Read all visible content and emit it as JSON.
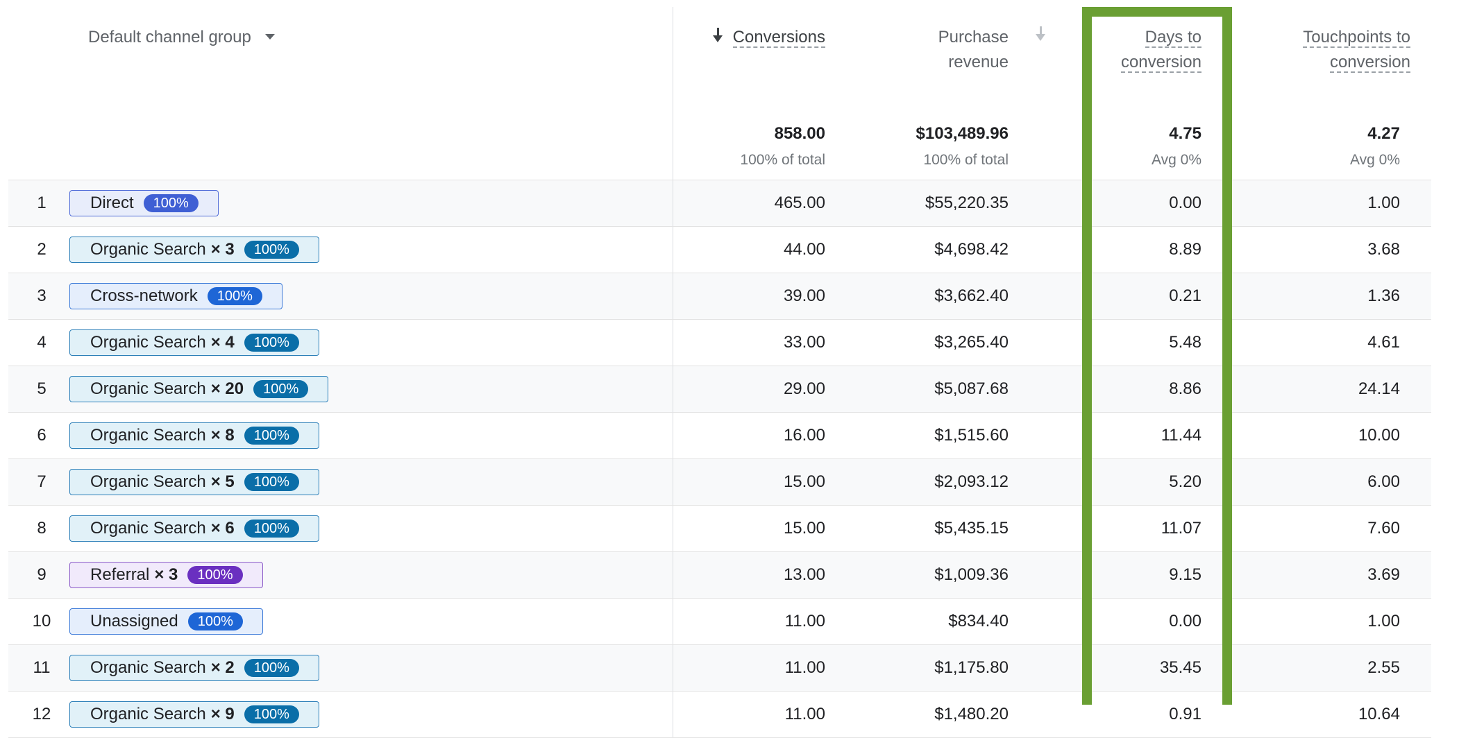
{
  "table": {
    "dimension_header": "Default channel group",
    "columns": {
      "conversions": "Conversions",
      "purchase_revenue_line1": "Purchase",
      "purchase_revenue_line2": "revenue",
      "days_line1": "Days to",
      "days_line2": "conversion",
      "touch_line1": "Touchpoints to",
      "touch_line2": "conversion"
    },
    "totals": {
      "conversions": "858.00",
      "conversions_sub": "100% of total",
      "revenue": "$103,489.96",
      "revenue_sub": "100% of total",
      "days": "4.75",
      "days_sub": "Avg 0%",
      "touchpoints": "4.27",
      "touchpoints_sub": "Avg 0%"
    },
    "rows": [
      {
        "rank": "1",
        "channel": "Direct",
        "count": "",
        "share": "100%",
        "conversions": "465.00",
        "revenue": "$55,220.35",
        "days": "0.00",
        "touchpoints": "1.00"
      },
      {
        "rank": "2",
        "channel": "Organic Search",
        "count": "× 3",
        "share": "100%",
        "conversions": "44.00",
        "revenue": "$4,698.42",
        "days": "8.89",
        "touchpoints": "3.68"
      },
      {
        "rank": "3",
        "channel": "Cross-network",
        "count": "",
        "share": "100%",
        "conversions": "39.00",
        "revenue": "$3,662.40",
        "days": "0.21",
        "touchpoints": "1.36"
      },
      {
        "rank": "4",
        "channel": "Organic Search",
        "count": "× 4",
        "share": "100%",
        "conversions": "33.00",
        "revenue": "$3,265.40",
        "days": "5.48",
        "touchpoints": "4.61"
      },
      {
        "rank": "5",
        "channel": "Organic Search",
        "count": "× 20",
        "share": "100%",
        "conversions": "29.00",
        "revenue": "$5,087.68",
        "days": "8.86",
        "touchpoints": "24.14"
      },
      {
        "rank": "6",
        "channel": "Organic Search",
        "count": "× 8",
        "share": "100%",
        "conversions": "16.00",
        "revenue": "$1,515.60",
        "days": "11.44",
        "touchpoints": "10.00"
      },
      {
        "rank": "7",
        "channel": "Organic Search",
        "count": "× 5",
        "share": "100%",
        "conversions": "15.00",
        "revenue": "$2,093.12",
        "days": "5.20",
        "touchpoints": "6.00"
      },
      {
        "rank": "8",
        "channel": "Organic Search",
        "count": "× 6",
        "share": "100%",
        "conversions": "15.00",
        "revenue": "$5,435.15",
        "days": "11.07",
        "touchpoints": "7.60"
      },
      {
        "rank": "9",
        "channel": "Referral",
        "count": "× 3",
        "share": "100%",
        "conversions": "13.00",
        "revenue": "$1,009.36",
        "days": "9.15",
        "touchpoints": "3.69"
      },
      {
        "rank": "10",
        "channel": "Unassigned",
        "count": "",
        "share": "100%",
        "conversions": "11.00",
        "revenue": "$834.40",
        "days": "0.00",
        "touchpoints": "1.00"
      },
      {
        "rank": "11",
        "channel": "Organic Search",
        "count": "× 2",
        "share": "100%",
        "conversions": "11.00",
        "revenue": "$1,175.80",
        "days": "35.45",
        "touchpoints": "2.55"
      },
      {
        "rank": "12",
        "channel": "Organic Search",
        "count": "× 9",
        "share": "100%",
        "conversions": "11.00",
        "revenue": "$1,480.20",
        "days": "0.91",
        "touchpoints": "10.64"
      }
    ]
  },
  "colors": {
    "highlight_border": "#6a9f33",
    "organic_chip_border": "#2c7fb8",
    "organic_badge": "#0a6ea8",
    "direct_badge": "#3f5fd4",
    "referral_badge": "#6a2fc0"
  }
}
